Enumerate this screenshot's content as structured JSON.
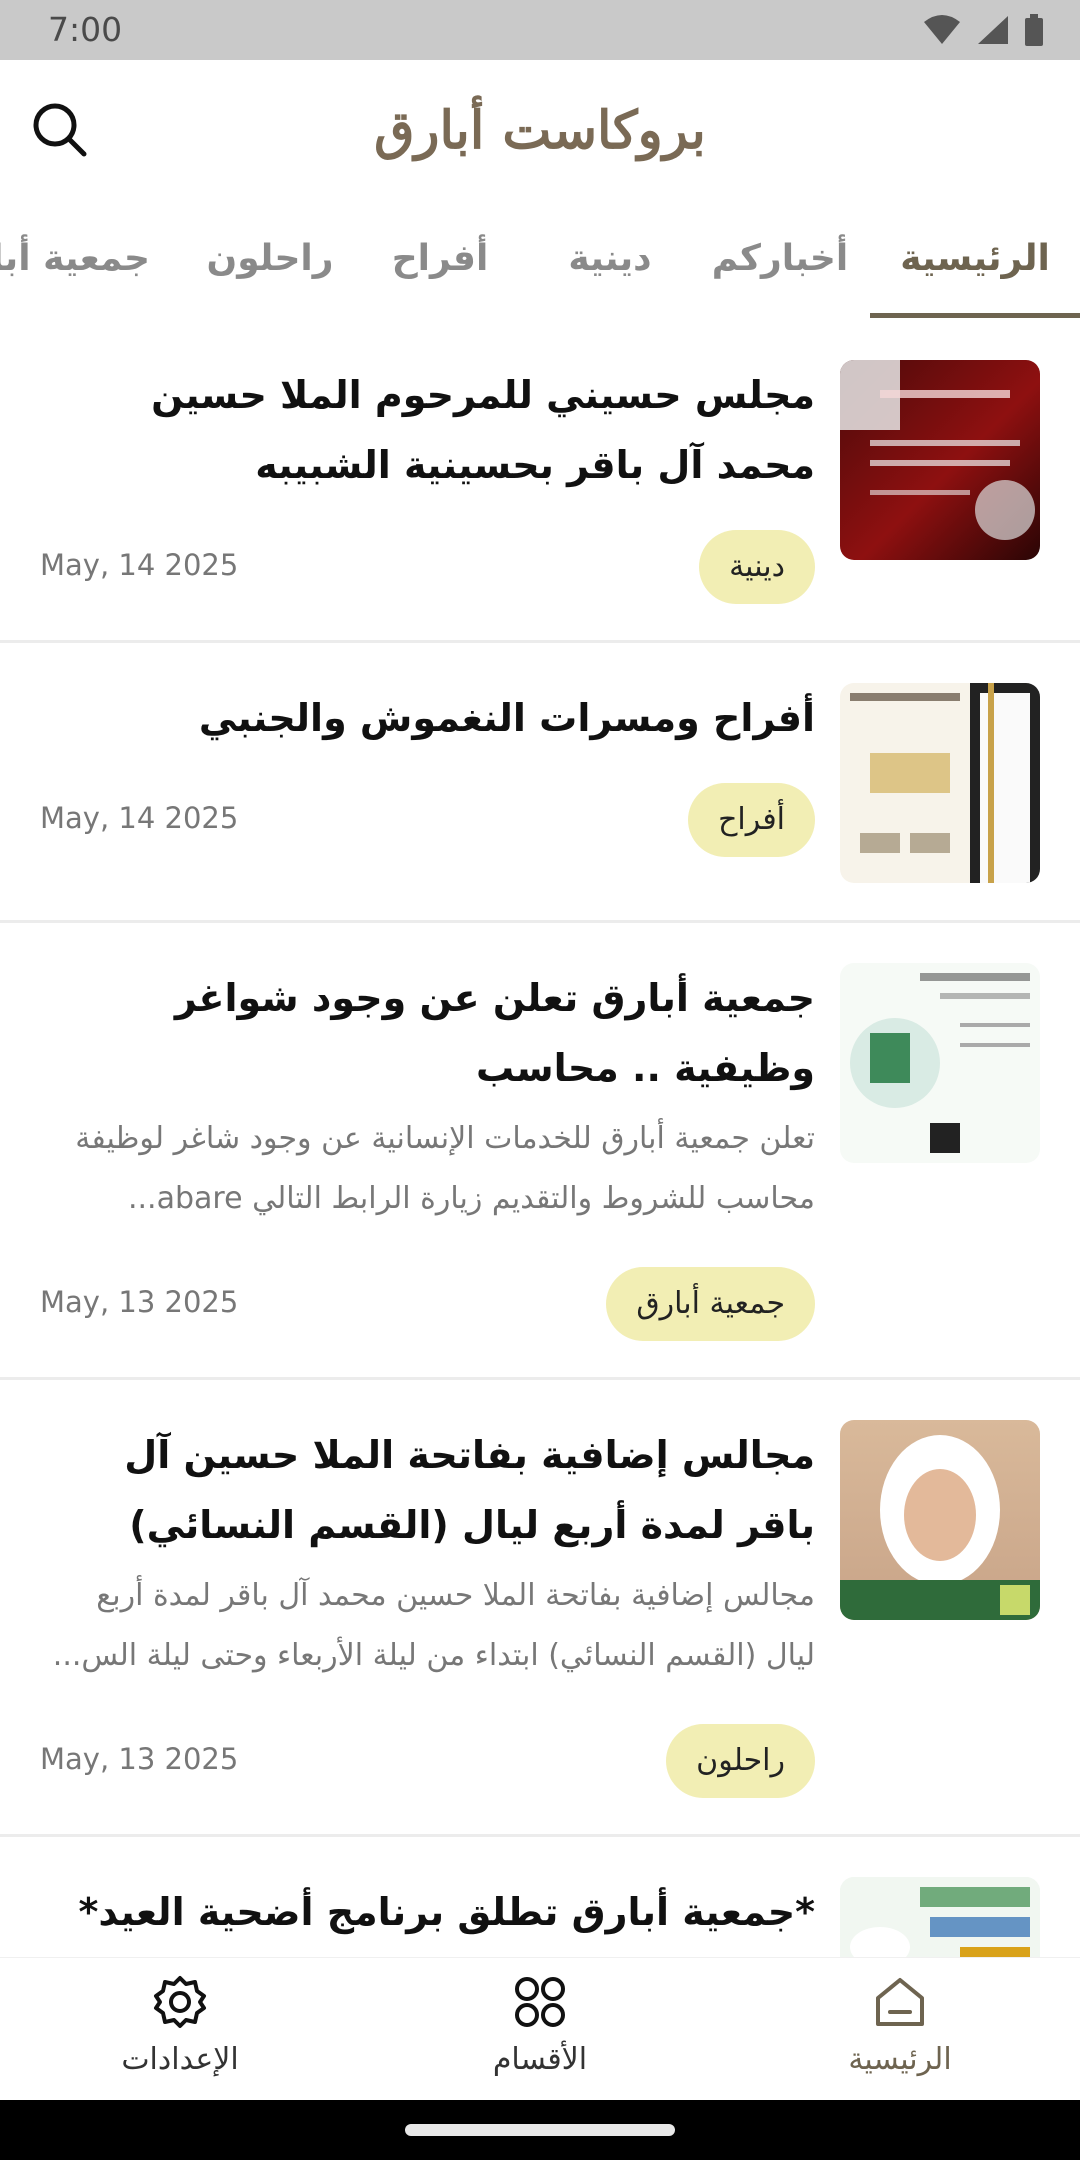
{
  "status_bar": {
    "time": "7:00"
  },
  "app_bar": {
    "title": "بروكاست أبارق",
    "search_icon": "search-icon"
  },
  "tabs": [
    {
      "label": "الرئيسية",
      "active": true
    },
    {
      "label": "أخباركم",
      "active": false
    },
    {
      "label": "دينية",
      "active": false
    },
    {
      "label": "أفراح",
      "active": false
    },
    {
      "label": "راحلون",
      "active": false
    },
    {
      "label": "جمعية أبارق",
      "active": false
    }
  ],
  "articles": [
    {
      "title": "مجلس حسيني للمرحوم الملا حسين محمد آل باقر بحسينية الشبيبه",
      "excerpt": "",
      "category": "دينية",
      "date": "May, 14 2025"
    },
    {
      "title": "أفراح ومسرات النغموش والجنبي",
      "excerpt": "",
      "category": "أفراح",
      "date": "May, 14 2025"
    },
    {
      "title": "جمعية أبارق تعلن عن وجود شواغر وظيفية .. محاسب",
      "excerpt": "تعلن جمعية أبارق للخدمات الإنسانية عن وجود شاغر لوظيفة محاسب للشروط والتقديم زيارة الرابط التالي abare...",
      "category": "جمعية أبارق",
      "date": "May, 13 2025"
    },
    {
      "title": "مجالس إضافية بفاتحة الملا حسين آل باقر لمدة أربع ليال (القسم النسائي)",
      "excerpt": "مجالس إضافية بفاتحة الملا حسين محمد آل باقر لمدة أربع ليال (القسم النسائي) ابتداء من ليلة الأربعاء وحتى ليلة الس...",
      "category": "راحلون",
      "date": "May, 13 2025"
    },
    {
      "title": "*جمعية أبارق تطلق برنامج أضحية العيد*",
      "excerpt": "",
      "category": "",
      "date": ""
    }
  ],
  "bottom_nav": [
    {
      "label": "الإعدادات",
      "icon": "gear-icon"
    },
    {
      "label": "الأقسام",
      "icon": "grid-icon"
    },
    {
      "label": "الرئيسية",
      "icon": "home-icon"
    }
  ],
  "colors": {
    "accent": "#6e6450",
    "badge_bg": "#f2eeb4",
    "status_bar": "#c9c9c9"
  }
}
